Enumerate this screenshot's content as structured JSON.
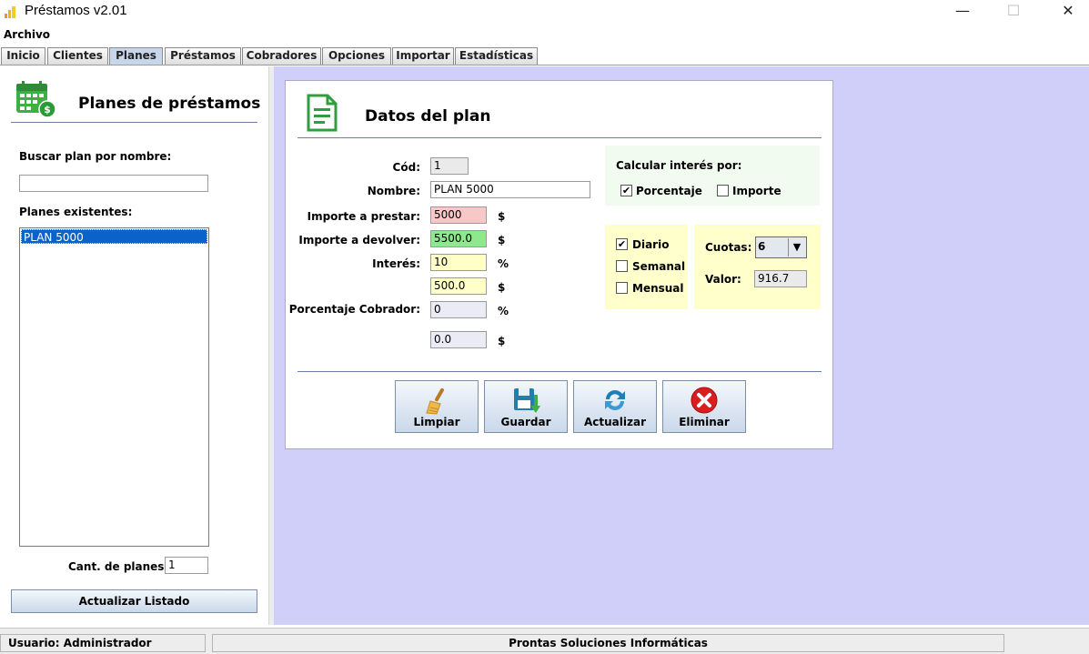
{
  "window": {
    "title": "Préstamos v2.01",
    "minimize": "—",
    "maximize": "☐",
    "close": "✕"
  },
  "menu": {
    "archivo": "Archivo"
  },
  "tabs": [
    "Inicio",
    "Clientes",
    "Planes",
    "Préstamos",
    "Cobradores",
    "Opciones",
    "Importar",
    "Estadísticas"
  ],
  "active_tab": "Planes",
  "left": {
    "title": "Planes de préstamos",
    "search_label": "Buscar plan por nombre:",
    "search_value": "",
    "list_label": "Planes existentes:",
    "plans": [
      "PLAN 5000"
    ],
    "count_label": "Cant. de planes",
    "count_value": "1",
    "refresh_button": "Actualizar Listado"
  },
  "plan": {
    "title": "Datos del plan",
    "cod_label": "Cód:",
    "cod_value": "1",
    "nombre_label": "Nombre:",
    "nombre_value": "PLAN 5000",
    "importe_prestar_label": "Importe a prestar:",
    "importe_prestar_value": "5000",
    "importe_devolver_label": "Importe a devolver:",
    "importe_devolver_value": "5500.0",
    "interes_label": "Interés:",
    "interes_value": "10",
    "interes_monto_value": "500.0",
    "porc_cobrador_label": "Porcentaje Cobrador:",
    "porc_cobrador_value": "0",
    "cobrador_monto_value": "0.0",
    "unit_currency": "$",
    "unit_percent": "%"
  },
  "calc": {
    "title": "Calcular interés por:",
    "porcentaje_label": "Porcentaje",
    "porcentaje_checked": true,
    "importe_label": "Importe",
    "importe_checked": false
  },
  "period": {
    "diario_label": "Diario",
    "diario_checked": true,
    "semanal_label": "Semanal",
    "semanal_checked": false,
    "mensual_label": "Mensual",
    "mensual_checked": false
  },
  "cuotas": {
    "cuotas_label": "Cuotas:",
    "cuotas_value": "6",
    "valor_label": "Valor:",
    "valor_value": "916.7"
  },
  "actions": {
    "limpiar": "Limpiar",
    "guardar": "Guardar",
    "actualizar": "Actualizar",
    "eliminar": "Eliminar"
  },
  "status": {
    "user": "Usuario:  Administrador",
    "company": "Prontas Soluciones Informáticas"
  },
  "colors": {
    "accent_green": "#2e9e3e",
    "panel_bg": "#cfcff9",
    "selection": "#0b63c9"
  }
}
